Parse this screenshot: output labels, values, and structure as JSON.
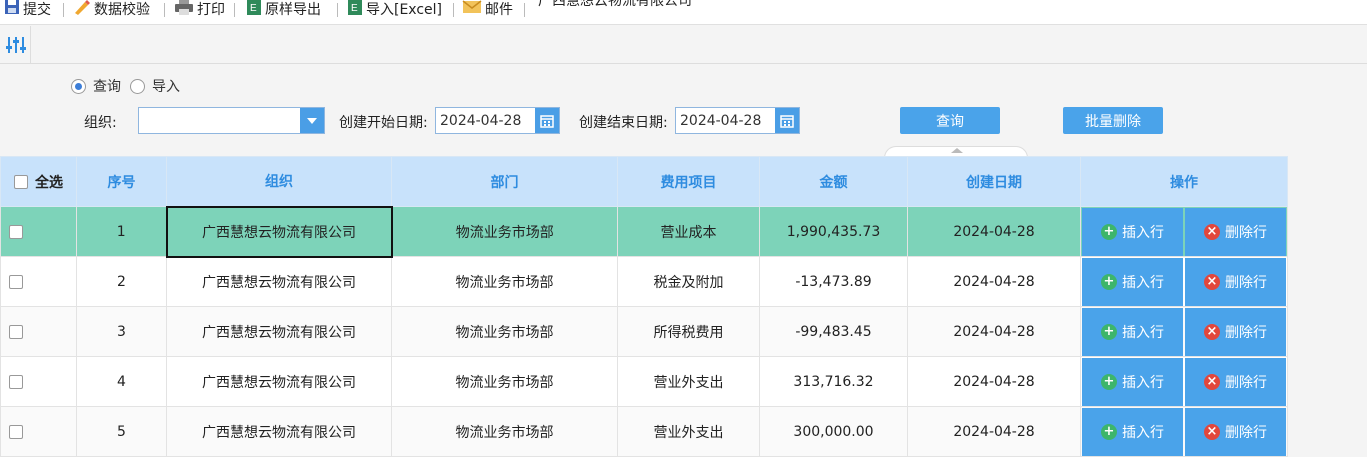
{
  "toolbar": {
    "submit": "提交",
    "validate": "数据校验",
    "print": "打印",
    "export": "原样导出",
    "import": "导入[Excel]",
    "mail": "邮件",
    "org_name": "广西慧想云物流有限公司"
  },
  "mode": {
    "query": "查询",
    "import": "导入",
    "selected": "query"
  },
  "filters": {
    "org_label": "组织:",
    "org_value": "",
    "start_label": "创建开始日期:",
    "start_value": "2024-04-28",
    "end_label": "创建结束日期:",
    "end_value": "2024-04-28",
    "query_button": "查询",
    "batch_delete_button": "批量删除"
  },
  "table": {
    "headers": {
      "select_all": "全选",
      "index": "序号",
      "org": "组织",
      "dept": "部门",
      "expense": "费用项目",
      "amount": "金额",
      "date": "创建日期",
      "ops": "操作"
    },
    "insert_label": "插入行",
    "delete_label": "删除行",
    "rows": [
      {
        "index": "1",
        "org": "广西慧想云物流有限公司",
        "dept": "物流业务市场部",
        "expense": "营业成本",
        "amount": "1,990,435.73",
        "date": "2024-04-28"
      },
      {
        "index": "2",
        "org": "广西慧想云物流有限公司",
        "dept": "物流业务市场部",
        "expense": "税金及附加",
        "amount": "-13,473.89",
        "date": "2024-04-28"
      },
      {
        "index": "3",
        "org": "广西慧想云物流有限公司",
        "dept": "物流业务市场部",
        "expense": "所得税费用",
        "amount": "-99,483.45",
        "date": "2024-04-28"
      },
      {
        "index": "4",
        "org": "广西慧想云物流有限公司",
        "dept": "物流业务市场部",
        "expense": "营业外支出",
        "amount": "313,716.32",
        "date": "2024-04-28"
      },
      {
        "index": "5",
        "org": "广西慧想云物流有限公司",
        "dept": "物流业务市场部",
        "expense": "营业外支出",
        "amount": "300,000.00",
        "date": "2024-04-28"
      }
    ]
  },
  "colors": {
    "accent": "#4aa3ea",
    "header_bg": "#c8e2fb",
    "header_text": "#2e8ce0",
    "selected_row": "#7dd3b9"
  }
}
